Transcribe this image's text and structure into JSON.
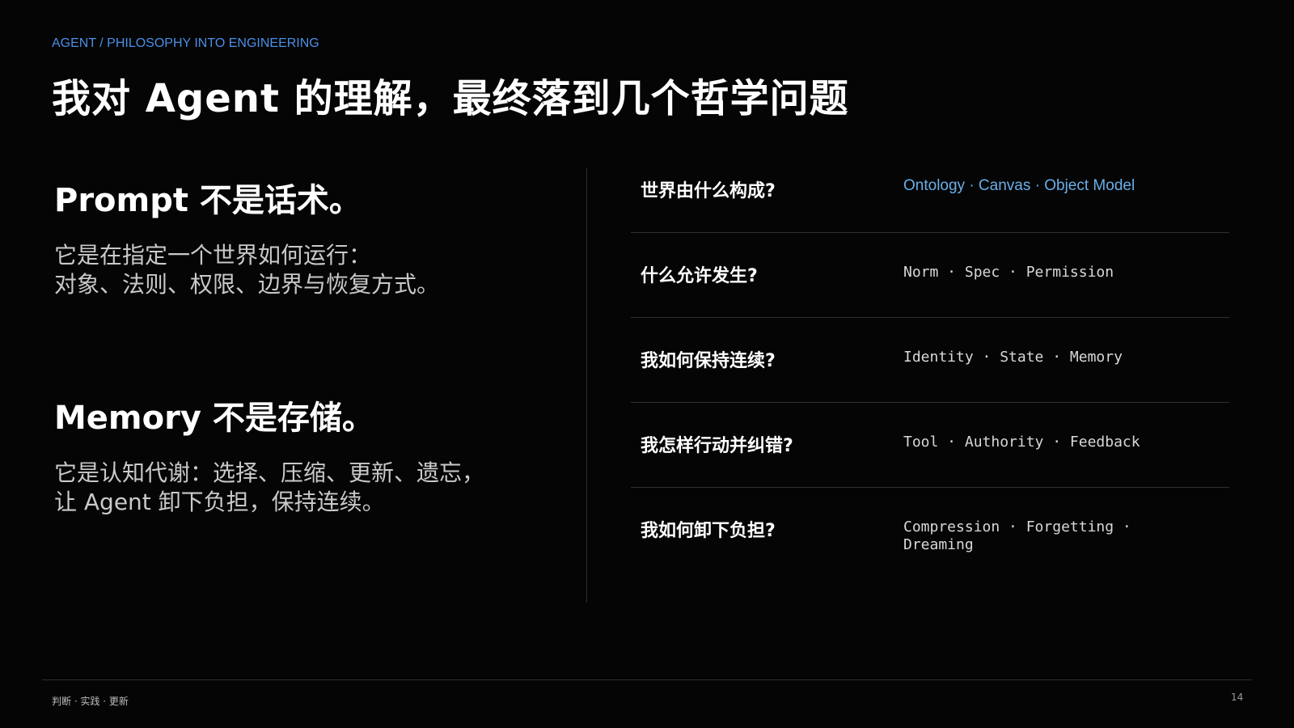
{
  "kicker": "AGENT / PHILOSOPHY INTO ENGINEERING",
  "title": "我对 Agent 的理解，最终落到几个哲学问题",
  "claims": [
    {
      "heading": "Prompt 不是话术。",
      "lines": [
        "它是在指定一个世界如何运行：",
        "对象、法则、权限、边界与恢复方式。"
      ]
    },
    {
      "heading": "Memory 不是存储。",
      "lines": [
        "它是认知代谢：选择、压缩、更新、遗忘，",
        "让 Agent 卸下负担，保持连续。"
      ]
    }
  ],
  "questions": [
    {
      "question": "世界由什么构成?",
      "concepts": "Ontology · Canvas · Object Model"
    },
    {
      "question": "什么允许发生?",
      "concepts": "Norm · Spec · Permission"
    },
    {
      "question": "我如何保持连续?",
      "concepts": "Identity · State · Memory"
    },
    {
      "question": "我怎样行动并纠错?",
      "concepts": "Tool · Authority · Feedback"
    },
    {
      "question": "我如何卸下负担?",
      "concepts": "Compression · Forgetting · Dreaming"
    }
  ],
  "footer": {
    "left": "判断 · 实践 · 更新",
    "page_number": "14"
  },
  "colors": {
    "background": "#050505",
    "accent": "#4a8fe6",
    "accent_light": "#6aaee8"
  }
}
